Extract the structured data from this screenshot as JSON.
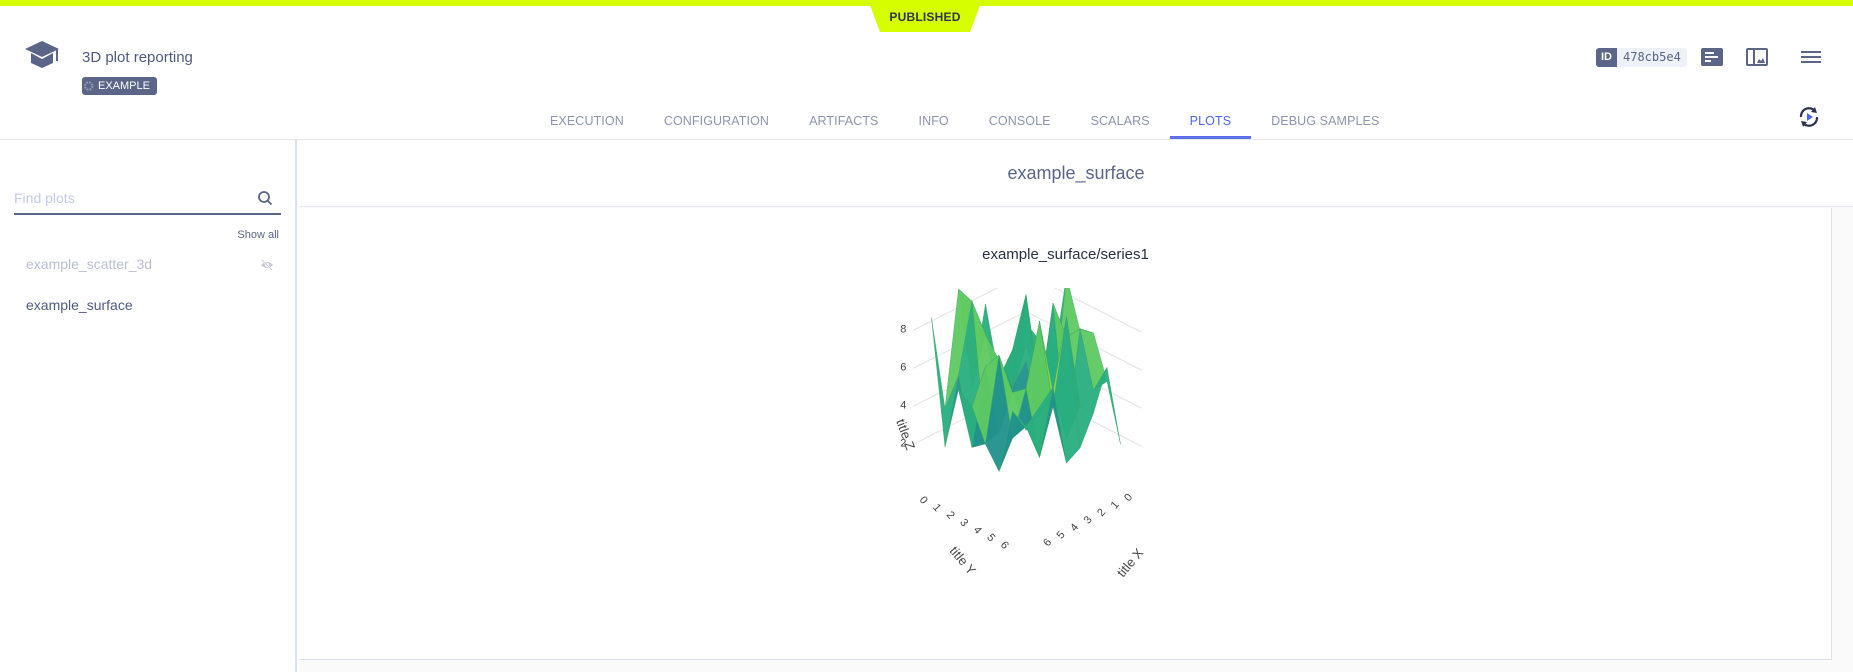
{
  "status_badge": "PUBLISHED",
  "header": {
    "title": "3D plot reporting",
    "tag": "EXAMPLE",
    "id_key": "ID",
    "id_value": "478cb5e4"
  },
  "tabs": [
    {
      "label": "EXECUTION",
      "active": false
    },
    {
      "label": "CONFIGURATION",
      "active": false
    },
    {
      "label": "ARTIFACTS",
      "active": false
    },
    {
      "label": "INFO",
      "active": false
    },
    {
      "label": "CONSOLE",
      "active": false
    },
    {
      "label": "SCALARS",
      "active": false
    },
    {
      "label": "PLOTS",
      "active": true
    },
    {
      "label": "DEBUG SAMPLES",
      "active": false
    }
  ],
  "sidebar": {
    "search_placeholder": "Find plots",
    "search_value": "",
    "show_all_label": "Show all",
    "plots": [
      {
        "label": "example_scatter_3d",
        "hidden": true
      },
      {
        "label": "example_surface",
        "hidden": false
      }
    ]
  },
  "main": {
    "section_title": "example_surface",
    "plot_title": "example_surface/series1",
    "chart_data": {
      "type": "surface3d",
      "title": "example_surface/series1",
      "xlabel": "title X",
      "ylabel": "title Y",
      "zlabel": "title Z",
      "x_ticks": [
        "0",
        "1",
        "2",
        "3",
        "4",
        "5",
        "6"
      ],
      "y_ticks": [
        "0",
        "1",
        "2",
        "3",
        "4",
        "5",
        "6"
      ],
      "z_ticks": [
        "2",
        "4",
        "6",
        "8"
      ],
      "colorscale": "viridis",
      "zlim": [
        0,
        9
      ]
    }
  },
  "colors": {
    "accent": "#d7fe00",
    "active_tab": "#4d66e8",
    "primary": "#5a6587"
  }
}
